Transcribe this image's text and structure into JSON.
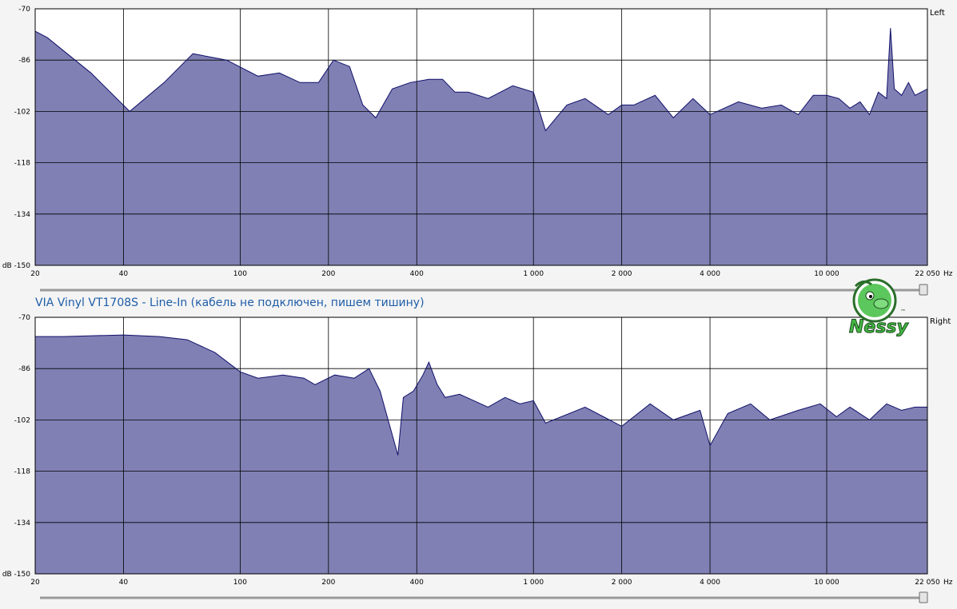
{
  "title": "VIA Vinyl VT1708S - Line-In (кабель не подключен, пишем тишину)",
  "unit_x": "Hz",
  "unit_y_prefix": "dB",
  "logo": {
    "text": "Nessy",
    "tm": "™"
  },
  "colors": {
    "fill": "#8080b4",
    "line": "#10106a",
    "plot_bg": "#ffffff",
    "grid": "#000000",
    "title": "#1f5ea8"
  },
  "chart_data": [
    {
      "type": "area",
      "channel": "Left",
      "xscale": "log",
      "xlim": [
        20,
        22050
      ],
      "ylim": [
        -150,
        -70
      ],
      "yticks": [
        -70,
        -86,
        -102,
        -118,
        -134,
        -150
      ],
      "ytick_labels": [
        "-70",
        "-86",
        "-102",
        "-118",
        "-134",
        "dB -150"
      ],
      "xticks": [
        20,
        40,
        100,
        200,
        400,
        1000,
        2000,
        4000,
        10000,
        22050
      ],
      "xtick_labels": [
        "20",
        "40",
        "100",
        "200",
        "400",
        "1 000",
        "2 000",
        "4 000",
        "10 000",
        "22 050"
      ],
      "x": [
        20,
        22,
        31,
        42,
        55,
        69,
        90,
        115,
        136,
        160,
        185,
        208,
        236,
        262,
        290,
        330,
        380,
        440,
        490,
        540,
        600,
        700,
        850,
        1000,
        1100,
        1300,
        1500,
        1800,
        2000,
        2200,
        2600,
        3000,
        3500,
        4000,
        5000,
        6000,
        7000,
        8000,
        9000,
        10000,
        11000,
        12000,
        13000,
        14000,
        15000,
        16000,
        16500,
        17000,
        18000,
        19000,
        20000,
        22050
      ],
      "y": [
        -77,
        -79,
        -90,
        -102,
        -93,
        -84,
        -86,
        -91,
        -90,
        -93,
        -93,
        -86,
        -88,
        -100,
        -104,
        -95,
        -93,
        -92,
        -92,
        -96,
        -96,
        -98,
        -94,
        -96,
        -108,
        -100,
        -98,
        -103,
        -100,
        -100,
        -97,
        -104,
        -98,
        -103,
        -99,
        -101,
        -100,
        -103,
        -97,
        -97,
        -98,
        -101,
        -99,
        -103,
        -96,
        -98,
        -76,
        -95,
        -97,
        -93,
        -97,
        -95
      ]
    },
    {
      "type": "area",
      "channel": "Right",
      "xscale": "log",
      "xlim": [
        20,
        22050
      ],
      "ylim": [
        -150,
        -70
      ],
      "yticks": [
        -70,
        -86,
        -102,
        -118,
        -134,
        -150
      ],
      "ytick_labels": [
        "-70",
        "-86",
        "-102",
        "-118",
        "-134",
        "dB -150"
      ],
      "xticks": [
        20,
        40,
        100,
        200,
        400,
        1000,
        2000,
        4000,
        10000,
        22050
      ],
      "xtick_labels": [
        "20",
        "40",
        "100",
        "200",
        "400",
        "1 000",
        "2 000",
        "4 000",
        "10 000",
        "22 050"
      ],
      "x": [
        20,
        25,
        40,
        53,
        66,
        82,
        100,
        115,
        140,
        165,
        180,
        210,
        245,
        275,
        300,
        345,
        360,
        390,
        420,
        440,
        470,
        500,
        560,
        700,
        800,
        900,
        1000,
        1100,
        1500,
        2000,
        2500,
        3000,
        3700,
        4000,
        4600,
        5500,
        6400,
        8000,
        9500,
        10800,
        12000,
        14000,
        16000,
        18000,
        20000,
        22050
      ],
      "y": [
        -76,
        -76,
        -75.5,
        -76,
        -77,
        -81,
        -87,
        -89,
        -88,
        -89,
        -91,
        -88,
        -89,
        -86,
        -93,
        -113,
        -95,
        -93,
        -88,
        -84,
        -91,
        -95,
        -94,
        -98,
        -95,
        -97,
        -96,
        -103,
        -98,
        -104,
        -97,
        -102,
        -99,
        -110,
        -100,
        -97,
        -102,
        -99,
        -97,
        -101,
        -98,
        -102,
        -97,
        -99,
        -98,
        -98
      ]
    }
  ]
}
